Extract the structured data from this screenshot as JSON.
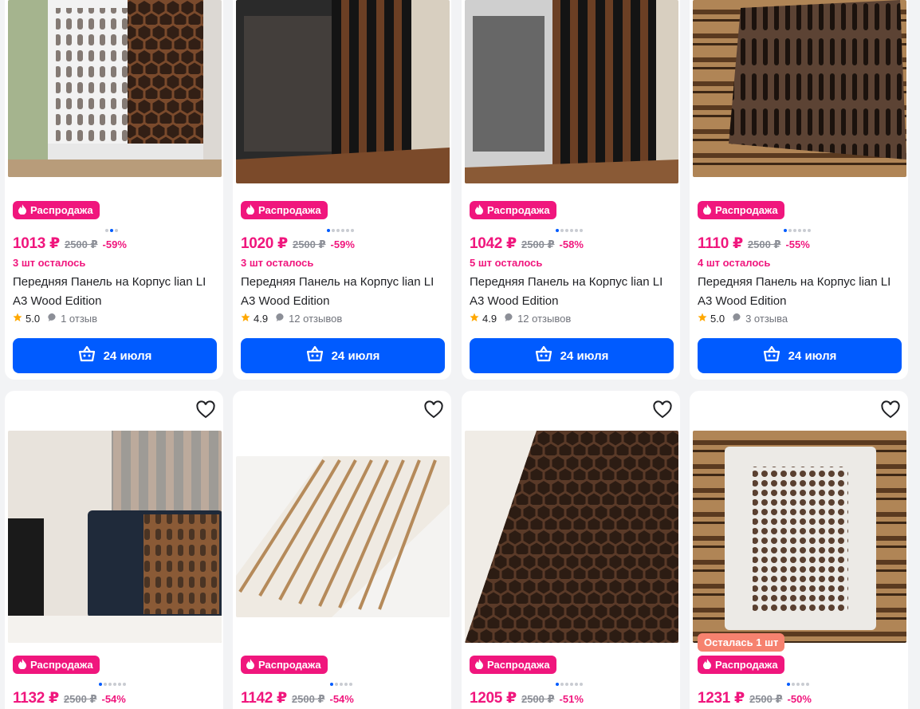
{
  "row1": [
    {
      "badge": "Распродажа",
      "price": "1013 ₽",
      "old_price": "2500 ₽",
      "discount": "-59%",
      "stock": "3 шт осталось",
      "title": "Передняя Панель на Корпус lian LI A3 Wood Edition",
      "rating": "5.0",
      "reviews": "1 отзыв",
      "button": "24 июля",
      "dots": 3,
      "active_dot": 1
    },
    {
      "badge": "Распродажа",
      "price": "1020 ₽",
      "old_price": "2500 ₽",
      "discount": "-59%",
      "stock": "3 шт осталось",
      "title": "Передняя Панель на Корпус lian LI A3 Wood Edition",
      "rating": "4.9",
      "reviews": "12 отзывов",
      "button": "24 июля",
      "dots": 6,
      "active_dot": 0
    },
    {
      "badge": "Распродажа",
      "price": "1042 ₽",
      "old_price": "2500 ₽",
      "discount": "-58%",
      "stock": "5 шт осталось",
      "title": "Передняя Панель на Корпус lian LI A3 Wood Edition",
      "rating": "4.9",
      "reviews": "12 отзывов",
      "button": "24 июля",
      "dots": 6,
      "active_dot": 0
    },
    {
      "badge": "Распродажа",
      "price": "1110 ₽",
      "old_price": "2500 ₽",
      "discount": "-55%",
      "stock": "4 шт осталось",
      "title": "Передняя Панель на Корпус lian LI A3 Wood Edition",
      "rating": "5.0",
      "reviews": "3 отзыва",
      "button": "24 июля",
      "dots": 6,
      "active_dot": 0
    }
  ],
  "row2": [
    {
      "badge": "Распродажа",
      "price": "1132 ₽",
      "old_price": "2500 ₽",
      "discount": "-54%",
      "dots": 6,
      "active_dot": 0
    },
    {
      "badge": "Распродажа",
      "price": "1142 ₽",
      "old_price": "2500 ₽",
      "discount": "-54%",
      "dots": 5,
      "active_dot": 0
    },
    {
      "badge": "Распродажа",
      "price": "1205 ₽",
      "old_price": "2500 ₽",
      "discount": "-51%",
      "dots": 6,
      "active_dot": 0
    },
    {
      "badge": "Распродажа",
      "price": "1231 ₽",
      "old_price": "2500 ₽",
      "discount": "-50%",
      "stock_badge": "Осталась 1 шт",
      "dots": 5,
      "active_dot": 0
    }
  ],
  "colors": {
    "accent": "#005bff",
    "sale": "#f0167d",
    "stock_badge": "#f6826f",
    "star": "#ffa800"
  },
  "icons": [
    "heart-icon",
    "fire-icon",
    "star-icon",
    "comment-icon",
    "basket-icon"
  ]
}
